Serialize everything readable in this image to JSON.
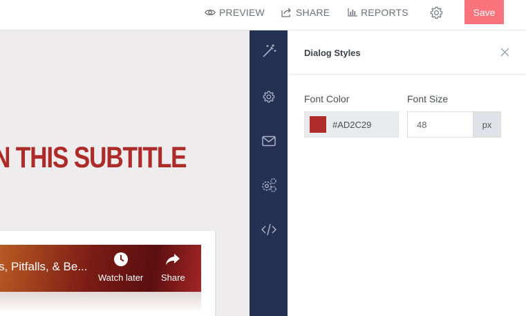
{
  "topbar": {
    "preview_label": "PREVIEW",
    "share_label": "SHARE",
    "reports_label": "REPORTS",
    "save_label": "Save"
  },
  "canvas": {
    "subtitle_text": "N THIS SUBTITLE",
    "video": {
      "title": "s, Pitfalls, & Be...",
      "watch_later_label": "Watch later",
      "share_label": "Share"
    }
  },
  "rail": {
    "icons": [
      "magic-wand-icon",
      "gear-icon",
      "envelope-icon",
      "gears-icon",
      "code-icon"
    ]
  },
  "panel": {
    "title": "Dialog Styles",
    "font_color_label": "Font Color",
    "font_color_value": "#AD2C29",
    "font_size_label": "Font Size",
    "font_size_value": "48",
    "font_size_unit": "px"
  },
  "colors": {
    "accent": "#ad2c29",
    "save_button": "#f8737c",
    "rail_background": "#243152",
    "canvas_background": "#eeeced"
  }
}
